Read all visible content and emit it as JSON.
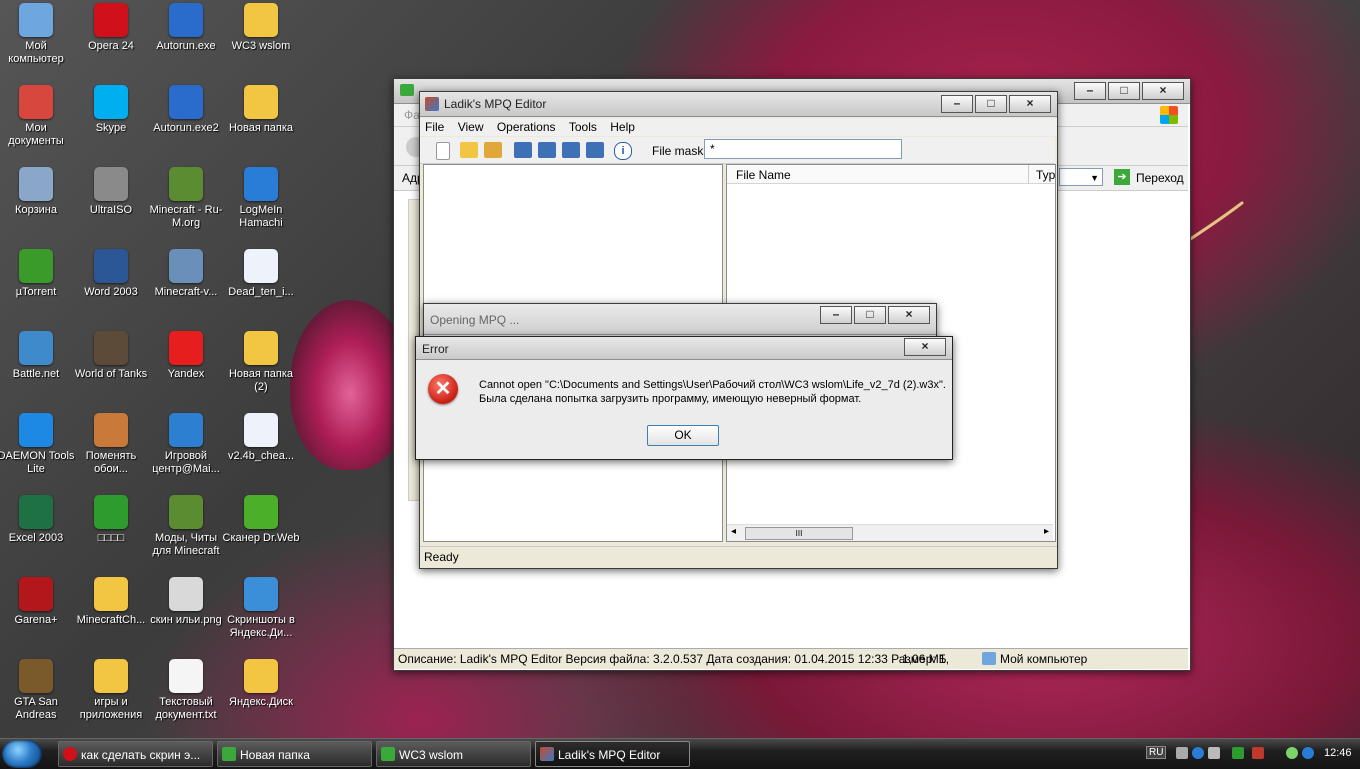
{
  "desktop_icons": [
    {
      "label": "Мой компьютер",
      "icon": "my-computer-icon",
      "color": "#6ea6e0"
    },
    {
      "label": "Opera 24",
      "icon": "opera-icon",
      "color": "#d0101a"
    },
    {
      "label": "Autorun.exe",
      "icon": "autorun-icon",
      "color": "#2a6ccc"
    },
    {
      "label": "WC3 wslom",
      "icon": "folder-icon",
      "color": "#f2c542"
    },
    {
      "label": "Мои документы",
      "icon": "my-documents-icon",
      "color": "#d8473e"
    },
    {
      "label": "Skype",
      "icon": "skype-icon",
      "color": "#00aff0"
    },
    {
      "label": "Autorun.exe2",
      "icon": "autorun-icon",
      "color": "#2a6ccc"
    },
    {
      "label": "Новая папка",
      "icon": "folder-icon",
      "color": "#f2c542"
    },
    {
      "label": "Корзина",
      "icon": "recycle-bin-icon",
      "color": "#8aa7c9"
    },
    {
      "label": "UltraISO",
      "icon": "ultraiso-icon",
      "color": "#8a8a8a"
    },
    {
      "label": "Minecraft - Ru-M.org",
      "icon": "minecraft-icon",
      "color": "#5b8c32"
    },
    {
      "label": "LogMeIn Hamachi",
      "icon": "hamachi-icon",
      "color": "#2a7dd6"
    },
    {
      "label": "µTorrent",
      "icon": "utorrent-icon",
      "color": "#3a9a2a"
    },
    {
      "label": "Word 2003",
      "icon": "word-icon",
      "color": "#2b5797"
    },
    {
      "label": "Minecraft-v...",
      "icon": "minecraft-installer-icon",
      "color": "#6a8fb8"
    },
    {
      "label": "Dead_ten_i...",
      "icon": "file-icon",
      "color": "#eef2fa"
    },
    {
      "label": "Battle.net",
      "icon": "battlenet-icon",
      "color": "#3e8acb"
    },
    {
      "label": "World of Tanks",
      "icon": "world-of-tanks-icon",
      "color": "#5d4b3a"
    },
    {
      "label": "Yandex",
      "icon": "yandex-icon",
      "color": "#e61e1e"
    },
    {
      "label": "Новая папка (2)",
      "icon": "folder-icon",
      "color": "#f2c542"
    },
    {
      "label": "DAEMON Tools Lite",
      "icon": "daemon-tools-icon",
      "color": "#1e88e5"
    },
    {
      "label": "Поменять обои...",
      "icon": "wallpaper-icon",
      "color": "#c97a3a"
    },
    {
      "label": "Игровой центр@Mai...",
      "icon": "game-center-icon",
      "color": "#2d7fd1"
    },
    {
      "label": "v2.4b_chea...",
      "icon": "file-icon",
      "color": "#eef2fa"
    },
    {
      "label": "Excel 2003",
      "icon": "excel-icon",
      "color": "#1e7145"
    },
    {
      "label": "□□□□",
      "icon": "shield-icon",
      "color": "#2e9b2e"
    },
    {
      "label": "Моды, Читы для Minecraft",
      "icon": "minecraft-icon",
      "color": "#5b8c32"
    },
    {
      "label": "Сканер Dr.Web",
      "icon": "drweb-icon",
      "color": "#4caf2a"
    },
    {
      "label": "Garena+",
      "icon": "garena-icon",
      "color": "#b3161b"
    },
    {
      "label": "MinecraftCh...",
      "icon": "folder-icon",
      "color": "#f2c542"
    },
    {
      "label": "скин ильи.png",
      "icon": "image-file-icon",
      "color": "#d9d9d9"
    },
    {
      "label": "Скриншоты в Яндекс.Ди...",
      "icon": "yandex-disk-screenshots-icon",
      "color": "#3a8fd8"
    },
    {
      "label": "GTA San Andreas",
      "icon": "gta-icon",
      "color": "#7a5a2a"
    },
    {
      "label": "игры и приложения",
      "icon": "folder-icon",
      "color": "#f2c542"
    },
    {
      "label": "Текстовый документ.txt",
      "icon": "text-file-icon",
      "color": "#f5f5f5"
    },
    {
      "label": "Яндекс.Диск",
      "icon": "yandex-disk-icon",
      "color": "#f2c542"
    }
  ],
  "explorer": {
    "address_label": "Адр",
    "go_label": "Переход",
    "status_text": "Описание: Ladik's MPQ Editor Версия файла: 3.2.0.537 Дата создания: 01.04.2015 12:33 Размер: 1,",
    "status_size": "1,06 МБ",
    "status_location": "Мой компьютер",
    "menu_partial": "Фа"
  },
  "mpq": {
    "title": "Ladik's MPQ Editor",
    "menu": [
      "File",
      "View",
      "Operations",
      "Tools",
      "Help"
    ],
    "file_mask_label": "File mask:",
    "file_mask_value": "*",
    "columns": [
      "File Name",
      "Typ"
    ],
    "status": "Ready",
    "scroll_grip": "III"
  },
  "opening_dialog": {
    "title": "Opening MPQ ..."
  },
  "error_dialog": {
    "title": "Error",
    "message_line1": "Cannot open \"C:\\Documents and Settings\\User\\Рабочий стол\\WC3 wslom\\Life_v2_7d (2).w3x\".",
    "message_line2": "Была сделана попытка загрузить программу, имеющую неверный формат.",
    "ok_label": "OK"
  },
  "taskbar": {
    "tasks": [
      {
        "label": "как сделать скрин э...",
        "icon": "opera-icon",
        "color": "#d0101a"
      },
      {
        "label": "Новая папка",
        "icon": "folder-icon",
        "color": "#3aa83a"
      },
      {
        "label": "WC3 wslom",
        "icon": "folder-icon",
        "color": "#3aa83a"
      },
      {
        "label": "Ladik's MPQ Editor",
        "icon": "mpq-editor-icon",
        "color": "#c84a2a"
      }
    ],
    "language": "RU",
    "time": "12:46"
  }
}
